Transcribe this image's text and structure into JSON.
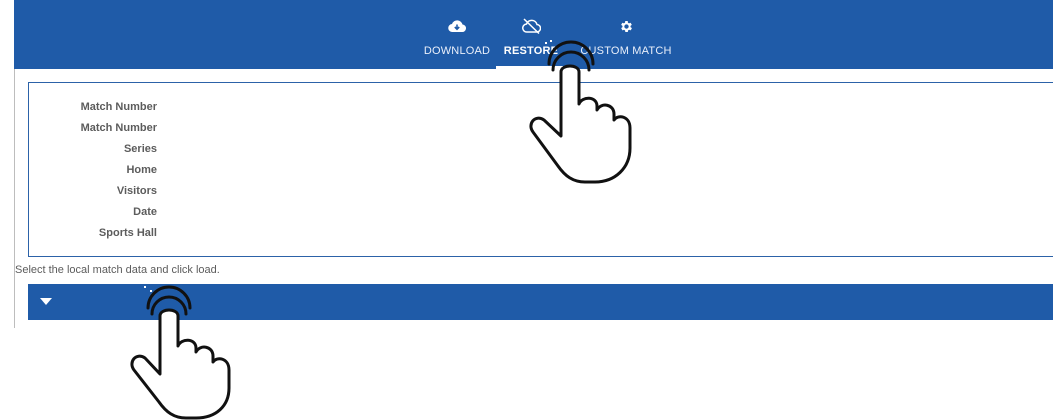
{
  "tabs": [
    {
      "label": "DOWNLOAD",
      "icon": "cloud-download-icon"
    },
    {
      "label": "RESTORE",
      "icon": "cloud-off-icon",
      "active": true
    },
    {
      "label": "CUSTOM MATCH",
      "icon": "gear-icon"
    }
  ],
  "info_fields": [
    {
      "label": "Match Number"
    },
    {
      "label": "Match Number"
    },
    {
      "label": "Series"
    },
    {
      "label": "Home"
    },
    {
      "label": "Visitors"
    },
    {
      "label": "Date"
    },
    {
      "label": "Sports Hall"
    }
  ],
  "hint": "Select the local match data and click load.",
  "select": {
    "value": "",
    "icon": "caret-down-icon"
  },
  "colors": {
    "accent": "#1f5ba8",
    "label_text": "#5c5c5c",
    "panel_border": "#2c62a8"
  },
  "overlay_icons": [
    "tap-hand-icon",
    "tap-hand-icon"
  ]
}
